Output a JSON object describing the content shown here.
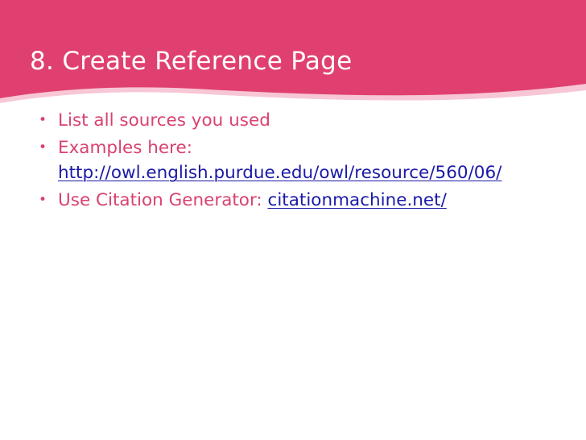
{
  "slide": {
    "title": "8. Create Reference Page",
    "colors": {
      "title_band": "#e0406f",
      "title_band_accent": "#f7c7d6",
      "bullet_text": "#d9426f",
      "link": "#1a1aa8",
      "background": "#ffffff"
    },
    "bullets": [
      {
        "text": "List all sources you used"
      },
      {
        "text": "Examples here:",
        "link": "http://owl.english.purdue.edu/owl/resource/560/06/"
      },
      {
        "text": "Use Citation Generator:",
        "link": "citationmachine.net/"
      }
    ],
    "bullet_glyph": "•"
  }
}
